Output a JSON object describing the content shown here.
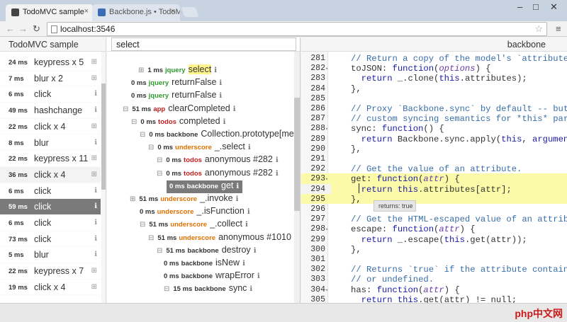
{
  "browser": {
    "tabs": [
      {
        "title": "TodoMVC sample",
        "active": true
      },
      {
        "title": "Backbone.js • TodoMVC",
        "active": false
      }
    ],
    "close_glyph": "×",
    "window_controls": {
      "minimize": "–",
      "maximize": "□",
      "close": "✕"
    },
    "nav": {
      "back": "←",
      "forward": "→",
      "reload": "↻"
    },
    "url": "localhost:3546",
    "star": "☆",
    "menu": "≡"
  },
  "left_panel": {
    "title": "TodoMVC sample",
    "rows": [
      {
        "ms": "24 ms",
        "label": "keypress x 5",
        "icon": "⊞",
        "state": "normal"
      },
      {
        "ms": "7 ms",
        "label": "blur x 2",
        "icon": "⊞",
        "state": "normal"
      },
      {
        "ms": "6 ms",
        "label": "click",
        "icon": "ℹ",
        "state": "normal"
      },
      {
        "ms": "49 ms",
        "label": "hashchange",
        "icon": "ℹ",
        "state": "normal"
      },
      {
        "ms": "22 ms",
        "label": "click x 4",
        "icon": "⊞",
        "state": "normal"
      },
      {
        "ms": "8 ms",
        "label": "blur",
        "icon": "ℹ",
        "state": "normal"
      },
      {
        "ms": "22 ms",
        "label": "keypress x 11",
        "icon": "⊞",
        "state": "normal"
      },
      {
        "ms": "36 ms",
        "label": "click x 4",
        "icon": "⊞",
        "state": "shaded"
      },
      {
        "ms": "6 ms",
        "label": "click",
        "icon": "ℹ",
        "state": "normal"
      },
      {
        "ms": "59 ms",
        "label": "click",
        "icon": "ℹ",
        "state": "selected"
      },
      {
        "ms": "6 ms",
        "label": "click",
        "icon": "ℹ",
        "state": "normal"
      },
      {
        "ms": "73 ms",
        "label": "click",
        "icon": "ℹ",
        "state": "normal"
      },
      {
        "ms": "5 ms",
        "label": "blur",
        "icon": "ℹ",
        "state": "normal"
      },
      {
        "ms": "22 ms",
        "label": "keypress x 7",
        "icon": "⊞",
        "state": "normal"
      },
      {
        "ms": "19 ms",
        "label": "click x 4",
        "icon": "⊞",
        "state": "normal"
      }
    ]
  },
  "middle_panel": {
    "search_value": "select",
    "rows": [
      {
        "toggle": "⊞",
        "ms": "1 ms",
        "lib": "jquery",
        "fn": "select",
        "highlight": true,
        "selected": false
      },
      {
        "toggle": "",
        "ms": "0 ms",
        "lib": "jquery",
        "fn": "returnFalse",
        "highlight": false,
        "selected": false
      },
      {
        "toggle": "",
        "ms": "0 ms",
        "lib": "jquery",
        "fn": "returnFalse",
        "highlight": false,
        "selected": false
      },
      {
        "toggle": "⊟",
        "ms": "51 ms",
        "lib": "app",
        "fn": "clearCompleted",
        "highlight": false,
        "selected": false
      },
      {
        "toggle": "⊟",
        "ms": "0 ms",
        "lib": "todos",
        "fn": "completed",
        "highlight": false,
        "selected": false
      },
      {
        "toggle": "⊟",
        "ms": "0 ms",
        "lib": "backbone",
        "fn": "Collection.prototype[method]",
        "highlight": false,
        "selected": false
      },
      {
        "toggle": "⊟",
        "ms": "0 ms",
        "lib": "underscore",
        "fn": "_.select",
        "highlight": false,
        "selected": false
      },
      {
        "toggle": "⊟",
        "ms": "0 ms",
        "lib": "todos",
        "fn": "anonymous #282",
        "highlight": false,
        "selected": false
      },
      {
        "toggle": "⊟",
        "ms": "0 ms",
        "lib": "todos",
        "fn": "anonymous #282",
        "highlight": false,
        "selected": false
      },
      {
        "toggle": "",
        "ms": "0 ms",
        "lib": "backbone",
        "fn": "get",
        "highlight": false,
        "selected": true
      },
      {
        "toggle": "⊞",
        "ms": "51 ms",
        "lib": "underscore",
        "fn": "_.invoke",
        "highlight": false,
        "selected": false
      },
      {
        "toggle": "",
        "ms": "0 ms",
        "lib": "underscore",
        "fn": "_.isFunction",
        "highlight": false,
        "selected": false
      },
      {
        "toggle": "⊟",
        "ms": "51 ms",
        "lib": "underscore",
        "fn": "_.collect",
        "highlight": false,
        "selected": false
      },
      {
        "toggle": "⊟",
        "ms": "51 ms",
        "lib": "underscore",
        "fn": "anonymous #1010",
        "highlight": false,
        "selected": false
      },
      {
        "toggle": "⊟",
        "ms": "51 ms",
        "lib": "backbone",
        "fn": "destroy",
        "highlight": false,
        "selected": false
      },
      {
        "toggle": "",
        "ms": "0 ms",
        "lib": "backbone",
        "fn": "isNew",
        "highlight": false,
        "selected": false
      },
      {
        "toggle": "",
        "ms": "0 ms",
        "lib": "backbone",
        "fn": "wrapError",
        "highlight": false,
        "selected": false
      },
      {
        "toggle": "⊟",
        "ms": "15 ms",
        "lib": "backbone",
        "fn": "sync",
        "highlight": false,
        "selected": false
      }
    ],
    "info_icon": "ℹ"
  },
  "right_panel": {
    "title": "backbone",
    "fold_glyph": "▾",
    "lines": [
      {
        "n": "281",
        "fold": false,
        "code": "// Return a copy of the model's `attributes` o",
        "kind": "comment"
      },
      {
        "n": "282",
        "fold": true,
        "code": "toJSON: function(options) {",
        "kind": "fn"
      },
      {
        "n": "283",
        "fold": false,
        "code": "  return _.clone(this.attributes);",
        "kind": "code"
      },
      {
        "n": "284",
        "fold": false,
        "code": "},",
        "kind": "code"
      },
      {
        "n": "285",
        "fold": false,
        "code": "",
        "kind": "code"
      },
      {
        "n": "286",
        "fold": false,
        "code": "// Proxy `Backbone.sync` by default -- but ov",
        "kind": "comment"
      },
      {
        "n": "287",
        "fold": false,
        "code": "// custom syncing semantics for *this* partic",
        "kind": "comment"
      },
      {
        "n": "288",
        "fold": true,
        "code": "sync: function() {",
        "kind": "fn"
      },
      {
        "n": "289",
        "fold": false,
        "code": "  return Backbone.sync.apply(this, arguments);",
        "kind": "code"
      },
      {
        "n": "290",
        "fold": false,
        "code": "},",
        "kind": "code"
      },
      {
        "n": "291",
        "fold": false,
        "code": "",
        "kind": "code"
      },
      {
        "n": "292",
        "fold": false,
        "code": "// Get the value of an attribute.",
        "kind": "comment"
      },
      {
        "n": "293",
        "fold": true,
        "code": "get: function(attr) {",
        "kind": "fn"
      },
      {
        "n": "294",
        "fold": false,
        "code": "  return this.attributes[attr];",
        "kind": "code"
      },
      {
        "n": "295",
        "fold": false,
        "code": "},",
        "kind": "code"
      },
      {
        "n": "296",
        "fold": false,
        "code": "",
        "kind": "code"
      },
      {
        "n": "297",
        "fold": false,
        "code": "// Get the HTML-escaped value of an attribute",
        "kind": "comment"
      },
      {
        "n": "298",
        "fold": true,
        "code": "escape: function(attr) {",
        "kind": "fn"
      },
      {
        "n": "299",
        "fold": false,
        "code": "  return _.escape(this.get(attr));",
        "kind": "code"
      },
      {
        "n": "300",
        "fold": false,
        "code": "},",
        "kind": "code"
      },
      {
        "n": "301",
        "fold": false,
        "code": "",
        "kind": "code"
      },
      {
        "n": "302",
        "fold": false,
        "code": "// Returns `true` if the attribute contains a",
        "kind": "comment"
      },
      {
        "n": "303",
        "fold": false,
        "code": "// or undefined.",
        "kind": "comment"
      },
      {
        "n": "304",
        "fold": true,
        "code": "has: function(attr) {",
        "kind": "fn"
      },
      {
        "n": "305",
        "fold": false,
        "code": "  return this.get(attr) != null;",
        "kind": "code"
      }
    ],
    "tooltip": "returns: true"
  },
  "watermark": "php中文网"
}
